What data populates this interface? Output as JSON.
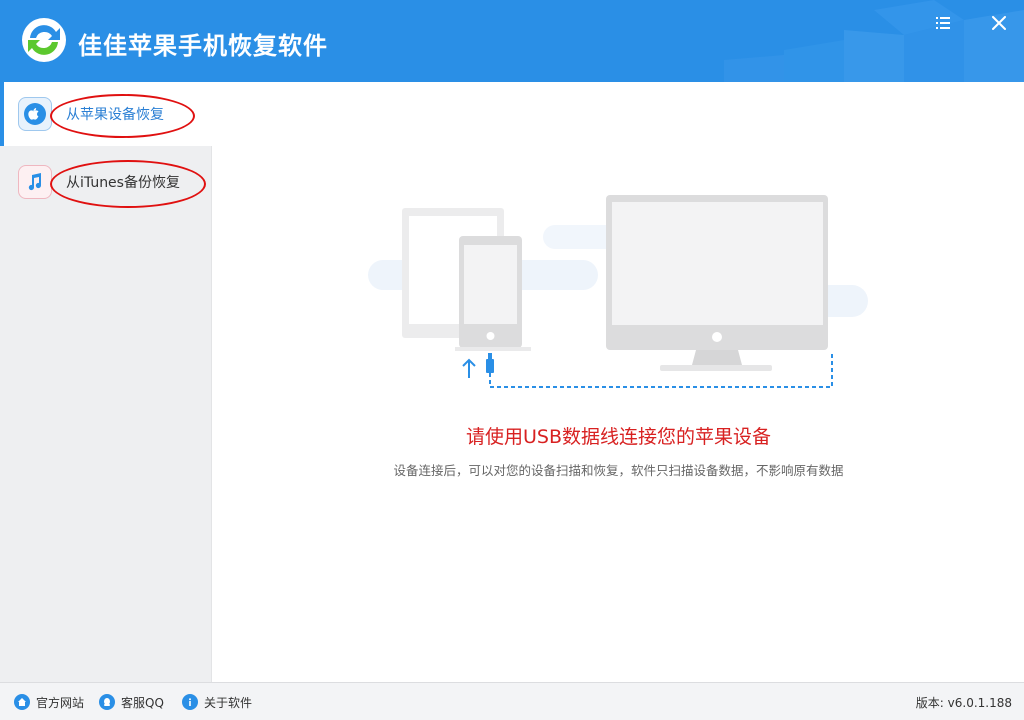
{
  "app": {
    "title": "佳佳苹果手机恢复软件"
  },
  "sidebar": {
    "items": [
      {
        "label": "从苹果设备恢复",
        "icon": "apple-icon",
        "active": true
      },
      {
        "label": "从iTunes备份恢复",
        "icon": "music-note-icon",
        "active": false
      }
    ]
  },
  "main": {
    "heading": "请使用USB数据线连接您的苹果设备",
    "subtitle": "设备连接后，可以对您的设备扫描和恢复，软件只扫描设备数据，不影响原有数据"
  },
  "footer": {
    "links": [
      {
        "label": "官方网站",
        "icon": "home-icon"
      },
      {
        "label": "客服QQ",
        "icon": "qq-icon"
      },
      {
        "label": "关于软件",
        "icon": "info-icon"
      }
    ],
    "version": "版本: v6.0.1.188"
  },
  "colors": {
    "titlebar": "#2a8fe6",
    "accent": "#2a8fe6",
    "heading": "#d82121",
    "annotation": "#e01010"
  }
}
